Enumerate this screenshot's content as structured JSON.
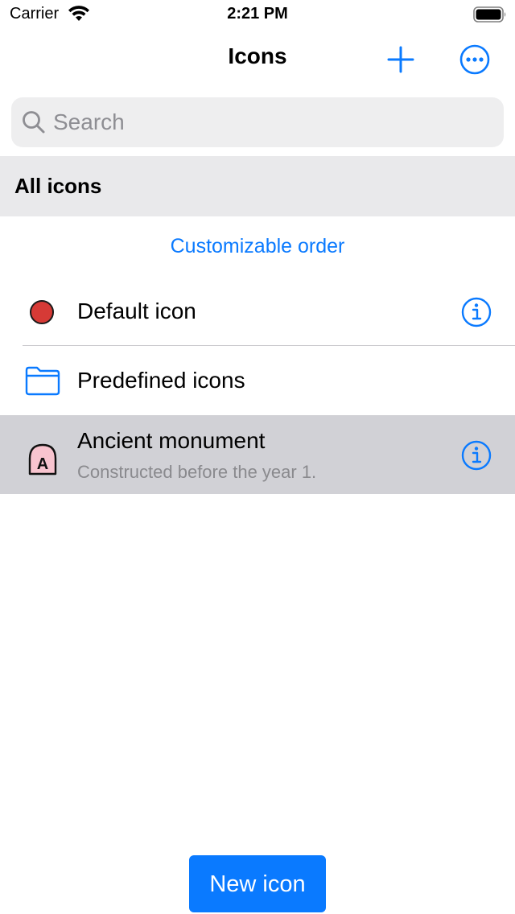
{
  "status_bar": {
    "carrier": "Carrier",
    "time": "2:21 PM",
    "icons": [
      "wifi-icon",
      "battery-icon"
    ]
  },
  "nav": {
    "title": "Icons",
    "add_icon": "plus-icon",
    "more_icon": "ellipsis-circle-icon"
  },
  "search": {
    "placeholder": "Search",
    "value": ""
  },
  "section": {
    "header": "All icons"
  },
  "order_link": "Customizable order",
  "rows": [
    {
      "title": "Default icon",
      "icon": "red-dot-icon",
      "has_info": true
    },
    {
      "title": "Predefined icons",
      "icon": "folder-icon",
      "has_info": false
    },
    {
      "title": "Ancient monument",
      "subtitle": "Constructed before the year 1.",
      "icon": "ancient-monument-icon",
      "icon_letter": "A",
      "has_info": true,
      "selected": true
    }
  ],
  "bottom_button": {
    "label": "New icon"
  },
  "colors": {
    "accent": "#0a7aff",
    "section_header_bg": "#e9e9eb",
    "selected_row_bg": "#d1d1d6",
    "red_dot": "#d63a36",
    "monument_fill": "#f8c4cf"
  }
}
